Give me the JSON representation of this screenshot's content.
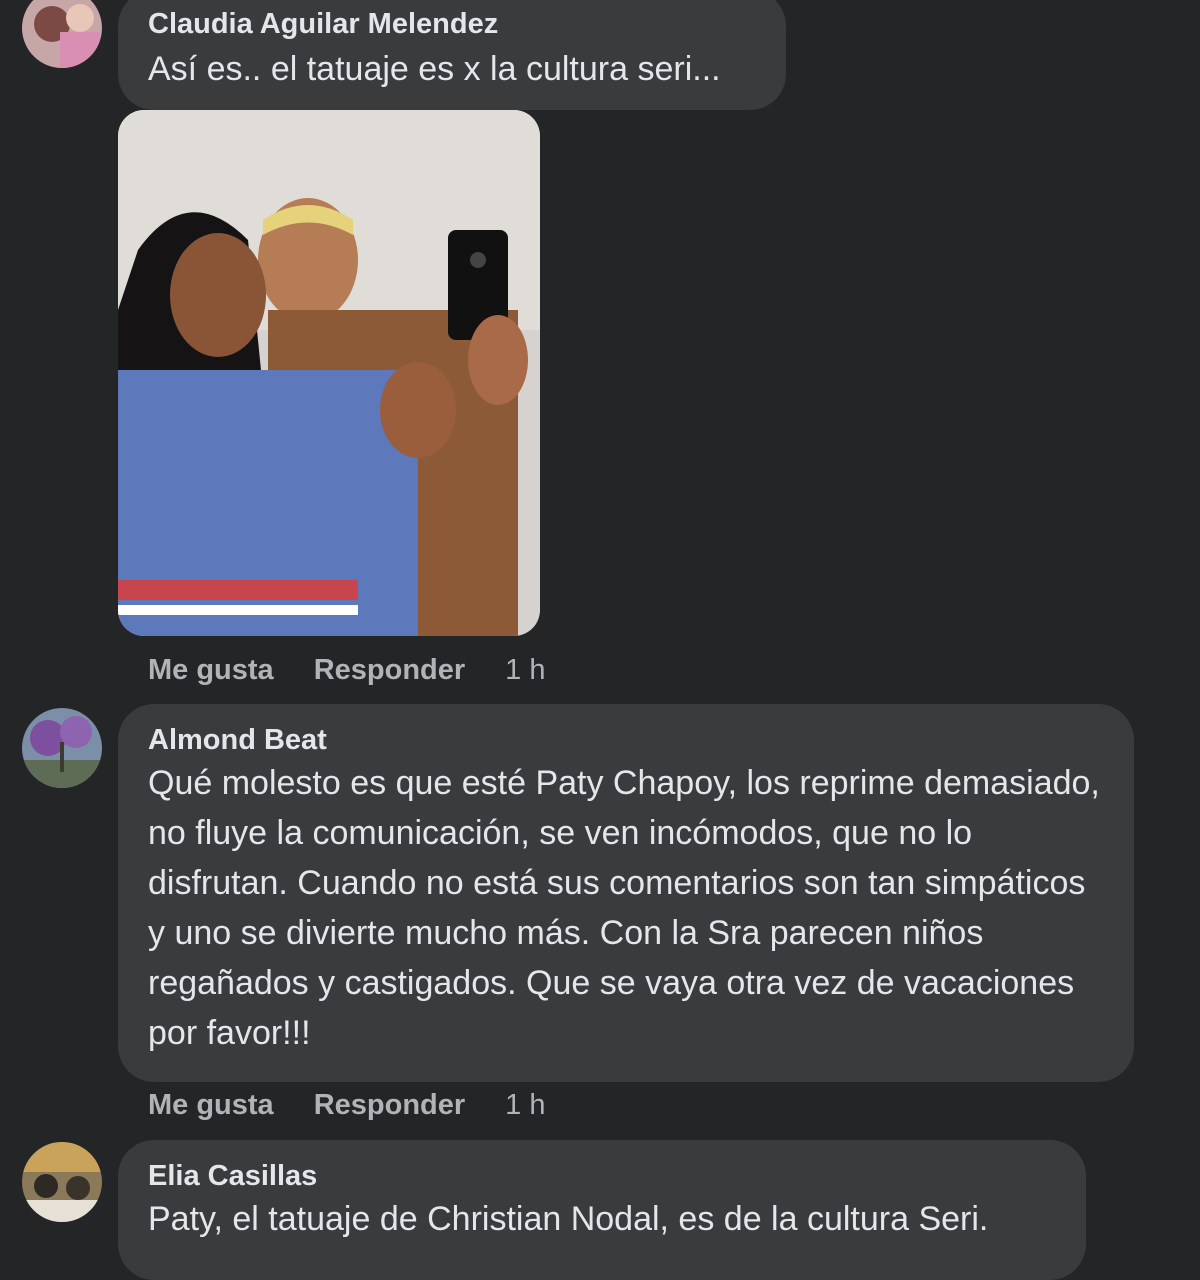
{
  "comments": [
    {
      "author": "Claudia Aguilar Melendez",
      "text": "Así es.. el tatuaje es x la cultura seri...",
      "actions": {
        "like": "Me gusta",
        "reply": "Responder",
        "time": "1 h"
      }
    },
    {
      "author": "Almond Beat",
      "text": "Qué molesto es que esté Paty Chapoy, los reprime demasiado, no fluye la comunicación, se ven incómodos, que no lo disfrutan. Cuando no está sus comentarios son tan simpáticos y uno se divierte mucho más. Con la Sra parecen niños regañados y castigados. Que se vaya otra vez de vacaciones por favor!!!",
      "actions": {
        "like": "Me gusta",
        "reply": "Responder",
        "time": "1 h"
      }
    },
    {
      "author": "Elia Casillas",
      "text": "Paty, el tatuaje de Christian Nodal, es de la cultura Seri."
    }
  ],
  "colors": {
    "background": "#242526",
    "bubble": "#3a3b3c",
    "text_primary": "#e4e6eb",
    "text_secondary": "#b0b3b8"
  }
}
